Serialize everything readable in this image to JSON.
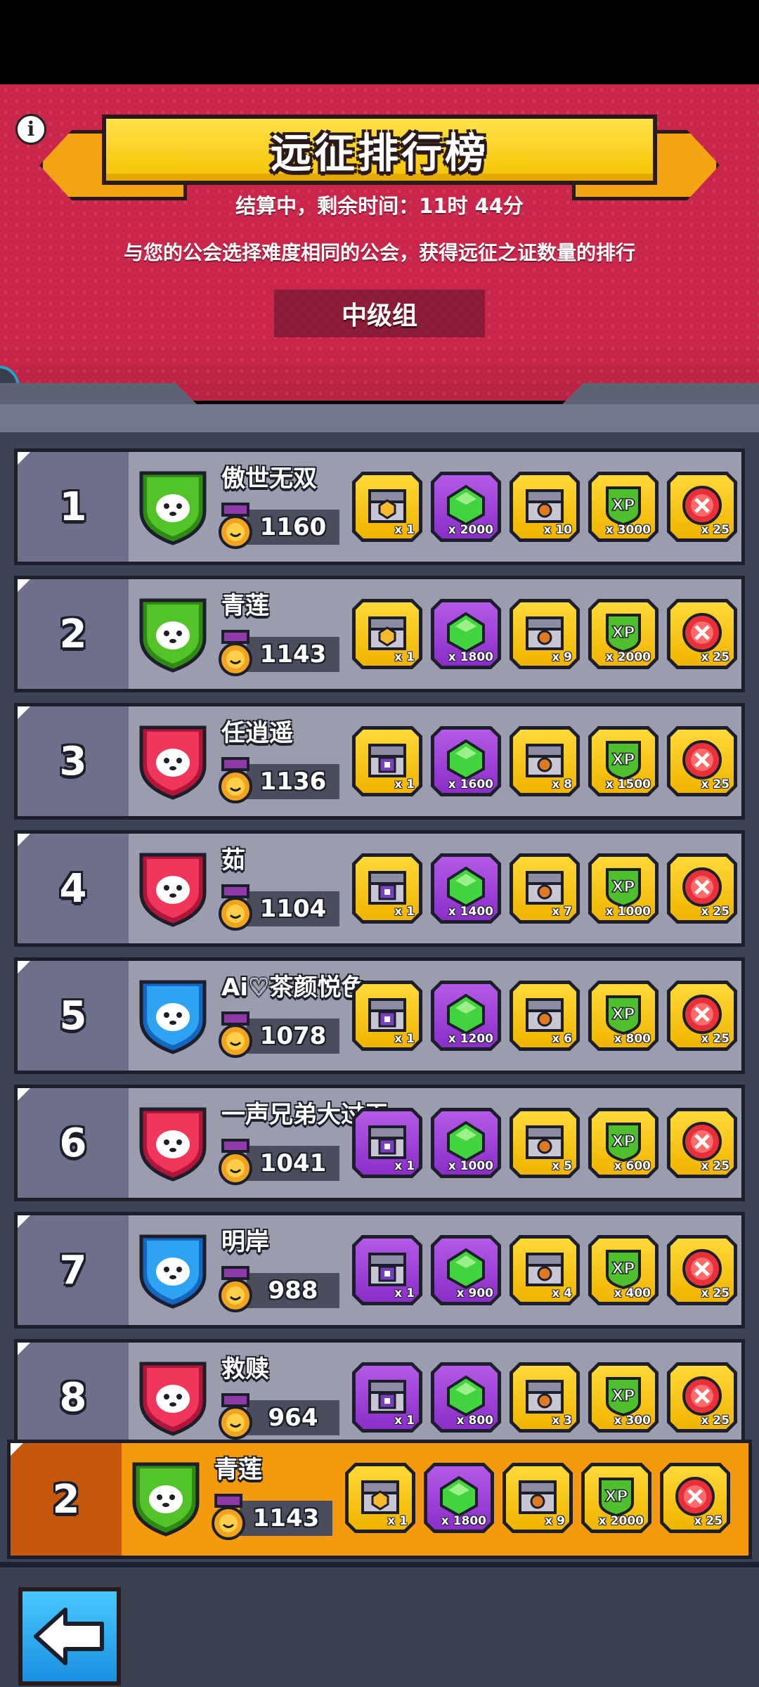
{
  "header": {
    "title": "远征排行榜",
    "countdown": "结算中，剩余时间：11时 44分",
    "subtitle": "与您的公会选择难度相同的公会，获得远征之证数量的排行",
    "group": "中级组",
    "info_icon": "info-icon"
  },
  "colors": {
    "header_bg": "#c8264a",
    "row_bg": "#9b9daf",
    "my_row_bg": "#f59a0c",
    "gold_frame": "#f5c300",
    "purple_frame": "#8a2ec8"
  },
  "rows": [
    {
      "rank": "1",
      "name": "傲世无双",
      "score": "1160",
      "badge": "raccoon-badge-icon",
      "badge_color": "green",
      "rewards": [
        {
          "icon": "gold-chest-icon",
          "frame": "gold",
          "qty": "x 1"
        },
        {
          "icon": "green-gem-icon",
          "frame": "purple",
          "qty": "x 2000"
        },
        {
          "icon": "chest-icon",
          "frame": "gold",
          "qty": "x 10"
        },
        {
          "icon": "xp-icon",
          "frame": "gold",
          "qty": "x 3000"
        },
        {
          "icon": "red-token-icon",
          "frame": "gold",
          "qty": "x 25"
        }
      ]
    },
    {
      "rank": "2",
      "name": "青莲",
      "score": "1143",
      "badge": "raccoon-badge-icon",
      "badge_color": "green",
      "rewards": [
        {
          "icon": "gold-chest-icon",
          "frame": "gold",
          "qty": "x 1"
        },
        {
          "icon": "green-gem-icon",
          "frame": "purple",
          "qty": "x 1800"
        },
        {
          "icon": "chest-icon",
          "frame": "gold",
          "qty": "x 9"
        },
        {
          "icon": "xp-icon",
          "frame": "gold",
          "qty": "x 2000"
        },
        {
          "icon": "red-token-icon",
          "frame": "gold",
          "qty": "x 25"
        }
      ]
    },
    {
      "rank": "3",
      "name": "任逍遥",
      "score": "1136",
      "badge": "cat-badge-icon",
      "badge_color": "red",
      "rewards": [
        {
          "icon": "purple-chest-icon",
          "frame": "gold",
          "qty": "x 1"
        },
        {
          "icon": "green-gem-icon",
          "frame": "purple",
          "qty": "x 1600"
        },
        {
          "icon": "chest-icon",
          "frame": "gold",
          "qty": "x 8"
        },
        {
          "icon": "xp-icon",
          "frame": "gold",
          "qty": "x 1500"
        },
        {
          "icon": "red-token-icon",
          "frame": "gold",
          "qty": "x 25"
        }
      ]
    },
    {
      "rank": "4",
      "name": "茹",
      "score": "1104",
      "badge": "rabbit-badge-icon",
      "badge_color": "red",
      "rewards": [
        {
          "icon": "purple-chest-icon",
          "frame": "gold",
          "qty": "x 1"
        },
        {
          "icon": "green-gem-icon",
          "frame": "purple",
          "qty": "x 1400"
        },
        {
          "icon": "chest-icon",
          "frame": "gold",
          "qty": "x 7"
        },
        {
          "icon": "xp-icon",
          "frame": "gold",
          "qty": "x 1000"
        },
        {
          "icon": "red-token-icon",
          "frame": "gold",
          "qty": "x 25"
        }
      ]
    },
    {
      "rank": "5",
      "name": "Ai♡茶颜悦色",
      "score": "1078",
      "badge": "eagle-badge-icon",
      "badge_color": "blue",
      "rewards": [
        {
          "icon": "purple-chest-icon",
          "frame": "gold",
          "qty": "x 1"
        },
        {
          "icon": "green-gem-icon",
          "frame": "purple",
          "qty": "x 1200"
        },
        {
          "icon": "chest-icon",
          "frame": "gold",
          "qty": "x 6"
        },
        {
          "icon": "xp-icon",
          "frame": "gold",
          "qty": "x 800"
        },
        {
          "icon": "red-token-icon",
          "frame": "gold",
          "qty": "x 25"
        }
      ]
    },
    {
      "rank": "6",
      "name": "一声兄弟大过天",
      "score": "1041",
      "badge": "bull-badge-icon",
      "badge_color": "red",
      "rewards": [
        {
          "icon": "purple-chest-icon",
          "frame": "purple",
          "qty": "x 1"
        },
        {
          "icon": "green-gem-icon",
          "frame": "purple",
          "qty": "x 1000"
        },
        {
          "icon": "chest-icon",
          "frame": "gold",
          "qty": "x 5"
        },
        {
          "icon": "xp-icon",
          "frame": "gold",
          "qty": "x 600"
        },
        {
          "icon": "red-token-icon",
          "frame": "gold",
          "qty": "x 25"
        }
      ]
    },
    {
      "rank": "7",
      "name": "明岸",
      "score": "988",
      "badge": "bear-badge-icon",
      "badge_color": "blue",
      "rewards": [
        {
          "icon": "purple-chest-icon",
          "frame": "purple",
          "qty": "x 1"
        },
        {
          "icon": "green-gem-icon",
          "frame": "purple",
          "qty": "x 900"
        },
        {
          "icon": "chest-icon",
          "frame": "gold",
          "qty": "x 4"
        },
        {
          "icon": "xp-icon",
          "frame": "gold",
          "qty": "x 400"
        },
        {
          "icon": "red-token-icon",
          "frame": "gold",
          "qty": "x 25"
        }
      ]
    },
    {
      "rank": "8",
      "name": "救赎",
      "score": "964",
      "badge": "cat-badge-icon",
      "badge_color": "red",
      "rewards": [
        {
          "icon": "purple-chest-icon",
          "frame": "purple",
          "qty": "x 1"
        },
        {
          "icon": "green-gem-icon",
          "frame": "purple",
          "qty": "x 800"
        },
        {
          "icon": "chest-icon",
          "frame": "gold",
          "qty": "x 3"
        },
        {
          "icon": "xp-icon",
          "frame": "gold",
          "qty": "x 300"
        },
        {
          "icon": "red-token-icon",
          "frame": "gold",
          "qty": "x 25"
        }
      ]
    }
  ],
  "my_rank": {
    "rank": "2",
    "name": "青莲",
    "score": "1143",
    "badge": "raccoon-badge-icon",
    "badge_color": "green",
    "rewards": [
      {
        "icon": "gold-chest-icon",
        "frame": "gold",
        "qty": "x 1"
      },
      {
        "icon": "green-gem-icon",
        "frame": "purple",
        "qty": "x 1800"
      },
      {
        "icon": "chest-icon",
        "frame": "gold",
        "qty": "x 9"
      },
      {
        "icon": "xp-icon",
        "frame": "gold",
        "qty": "x 2000"
      },
      {
        "icon": "red-token-icon",
        "frame": "gold",
        "qty": "x 25"
      }
    ]
  },
  "footer": {
    "back_icon": "back-arrow-icon"
  }
}
